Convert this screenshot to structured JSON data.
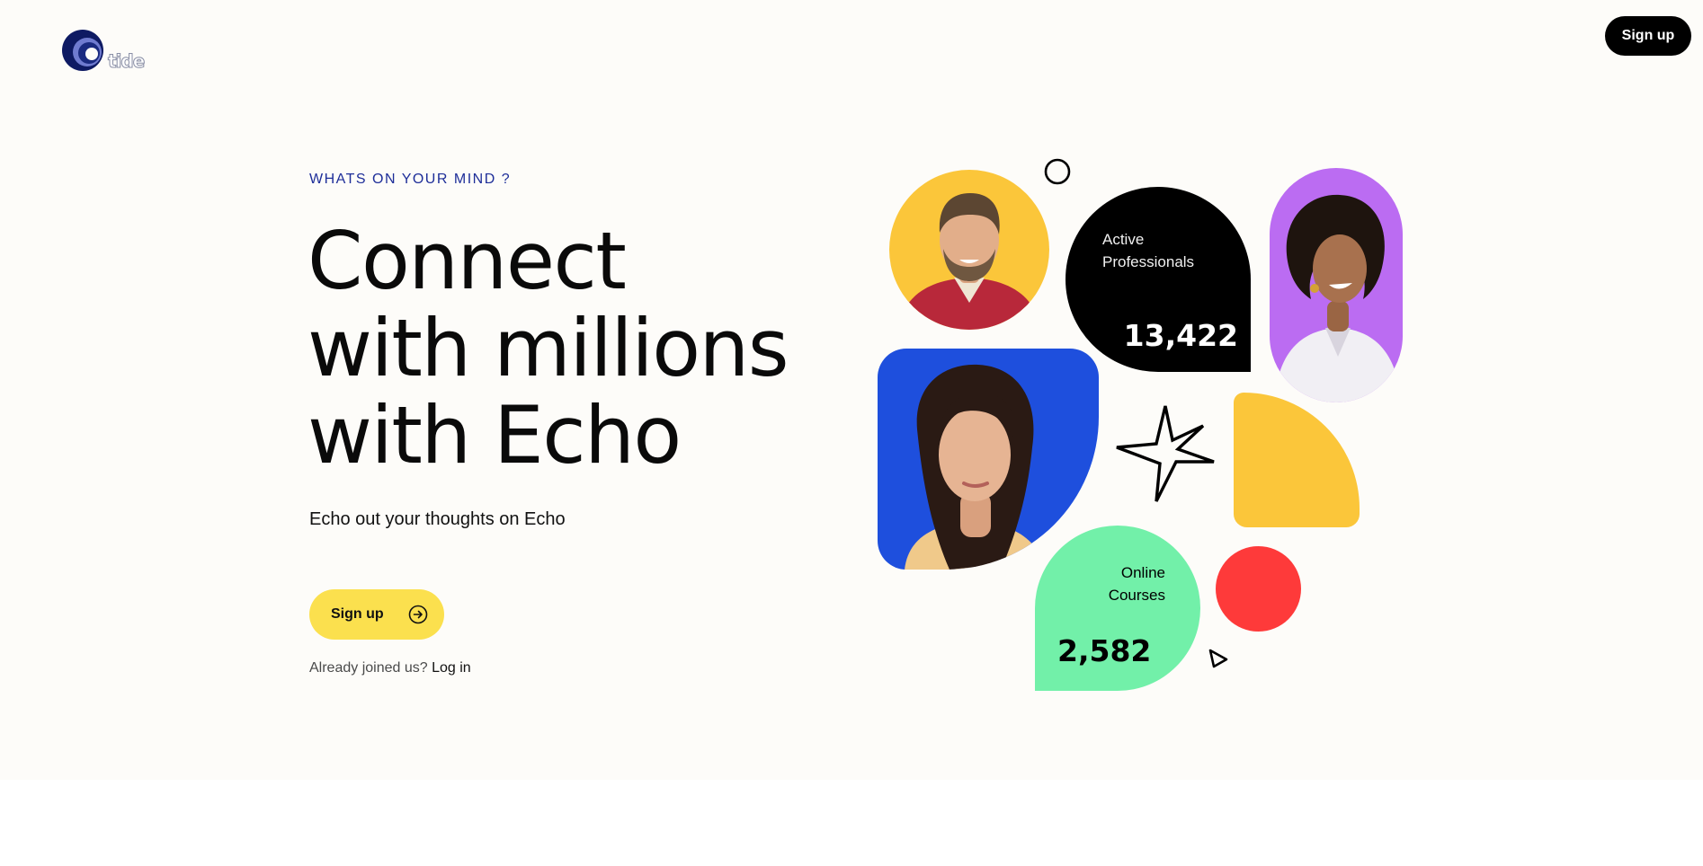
{
  "header": {
    "logo_text": "tide",
    "signup_label": "Sign up"
  },
  "hero": {
    "eyebrow": "WHATS ON YOUR MIND ?",
    "headline": [
      "Connect",
      "with millions",
      "with Echo"
    ],
    "subtext": "Echo out your thoughts on Echo",
    "cta_label": "Sign up",
    "already_prompt": "Already joined us?",
    "login_label": "Log in"
  },
  "collage": {
    "stats": [
      {
        "label_lines": [
          "Active",
          "Professionals"
        ],
        "value": "13,422"
      },
      {
        "label_lines": [
          "Online",
          "Courses"
        ],
        "value": "2,582"
      }
    ],
    "icons": {
      "ring": "ring-icon",
      "star": "sparkle-star-icon",
      "triangle": "triangle-pointer-icon",
      "cta": "arrow-right-circle-icon"
    }
  },
  "colors": {
    "background": "#fdfcf9",
    "eyebrow": "#1e2e99",
    "cta": "#fbe04e",
    "yellow": "#fbc63a",
    "purple": "#bb6cf2",
    "blue": "#1e4fdd",
    "green": "#72f0a9",
    "red": "#fe3a3a"
  }
}
